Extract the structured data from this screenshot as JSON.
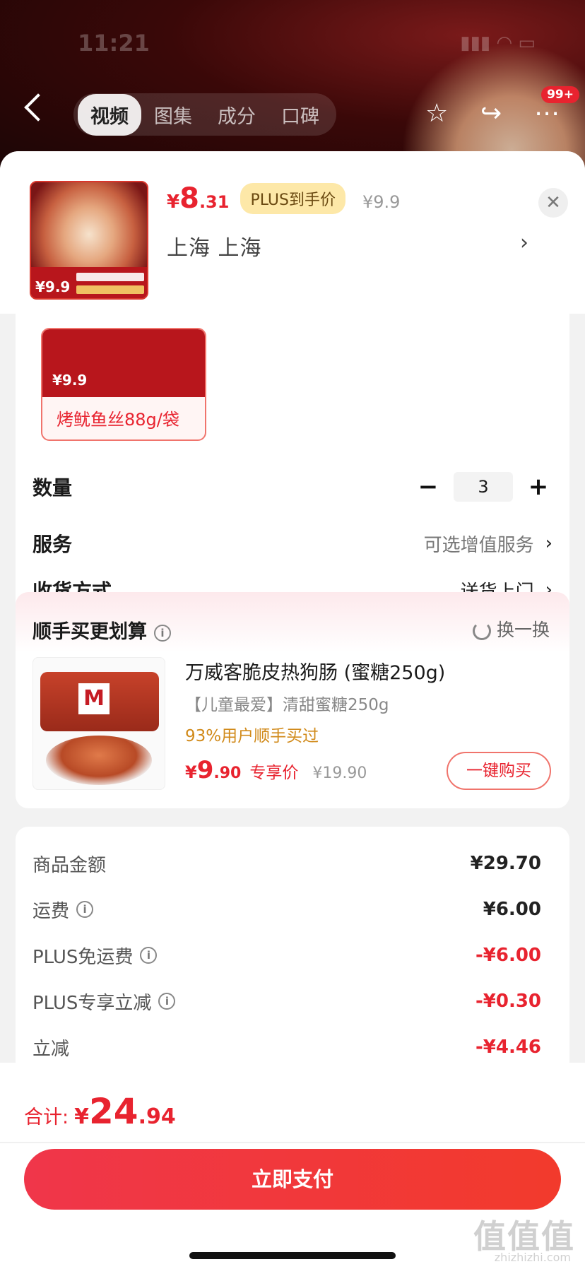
{
  "status": {
    "time": "11:21"
  },
  "nav": {
    "tabs": [
      {
        "label": "视频"
      },
      {
        "label": "图集"
      },
      {
        "label": "成分"
      },
      {
        "label": "口碑"
      }
    ],
    "badge": "99+"
  },
  "header": {
    "currency": "¥",
    "price_int": "8",
    "price_dec": ".31",
    "plus_tag": "PLUS到手价",
    "original_price": "¥9.9",
    "address": "上海  上海",
    "thumb_price": "¥9.9"
  },
  "variant": {
    "label": "烤鱿鱼丝88g/袋"
  },
  "options": {
    "quantity_label": "数量",
    "quantity_value": "3",
    "minus": "−",
    "plus": "+",
    "service_label": "服务",
    "service_value": "可选增值服务",
    "delivery_label": "收货方式",
    "delivery_value": "送货上门"
  },
  "recommend": {
    "title": "顺手买更划算",
    "swap": "换一换",
    "product_title": "万威客脆皮热狗肠 (蜜糖250g)",
    "product_sub": "【儿童最爱】清甜蜜糖250g",
    "hint": "93%用户顺手买过",
    "currency": "¥",
    "price_int": "9",
    "price_dec": ".90",
    "exclusive": "专享价",
    "original": "¥19.90",
    "buy_button": "一键购买"
  },
  "fees": [
    {
      "label": "商品金额",
      "amount": "¥29.70",
      "info": false,
      "red": false
    },
    {
      "label": "运费",
      "amount": "¥6.00",
      "info": true,
      "red": false
    },
    {
      "label": "PLUS免运费",
      "amount": "-¥6.00",
      "info": true,
      "red": true
    },
    {
      "label": "PLUS专享立减",
      "amount": "-¥0.30",
      "info": true,
      "red": true
    },
    {
      "label": "立减",
      "amount": "-¥4.46",
      "info": false,
      "red": true
    }
  ],
  "footer": {
    "total_label": "合计:",
    "currency": "¥",
    "total_int": "24",
    "total_dec": ".94",
    "pay_button": "立即支付"
  },
  "watermark": {
    "text": "值值值",
    "sub": "zhizhizhi.com"
  },
  "colors": {
    "accent": "#e8232f",
    "plus_bg": "#fde8a8",
    "hint": "#d18a1a"
  }
}
